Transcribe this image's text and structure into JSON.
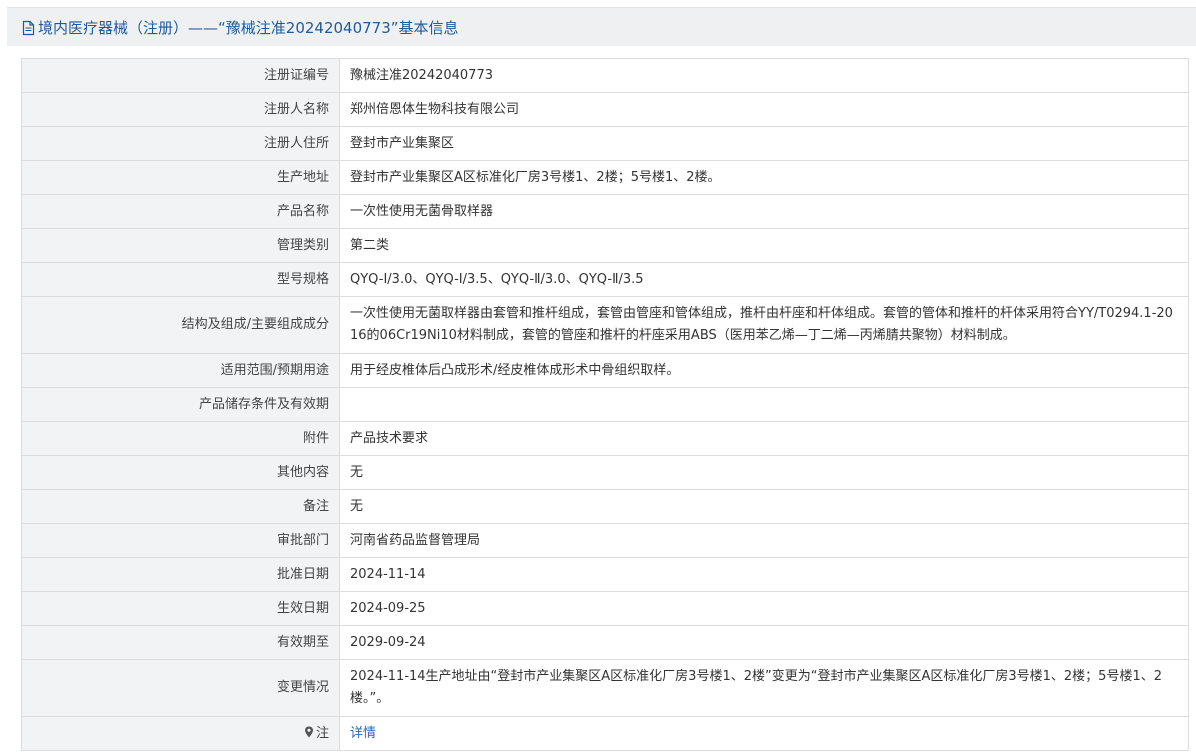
{
  "header": {
    "title": "境内医疗器械（注册）——“豫械注准20242040773”基本信息",
    "icon": "document-icon"
  },
  "rows": [
    {
      "key": "reg_no",
      "label": "注册证编号",
      "value": "豫械注准20242040773"
    },
    {
      "key": "registrant",
      "label": "注册人名称",
      "value": "郑州倍恩体生物科技有限公司"
    },
    {
      "key": "registrant_addr",
      "label": "注册人住所",
      "value": "登封市产业集聚区"
    },
    {
      "key": "production_addr",
      "label": "生产地址",
      "value": "登封市产业集聚区A区标准化厂房3号楼1、2楼；5号楼1、2楼。"
    },
    {
      "key": "product_name",
      "label": "产品名称",
      "value": "一次性使用无菌骨取样器"
    },
    {
      "key": "category",
      "label": "管理类别",
      "value": "第二类"
    },
    {
      "key": "models",
      "label": "型号规格",
      "value": "QYQ-Ⅰ/3.0、QYQ-Ⅰ/3.5、QYQ-Ⅱ/3.0、QYQ-Ⅱ/3.5"
    },
    {
      "key": "structure",
      "label": "结构及组成/主要组成成分",
      "value": "一次性使用无菌取样器由套管和推杆组成，套管由管座和管体组成，推杆由杆座和杆体组成。套管的管体和推杆的杆体采用符合YY/T0294.1-2016的06Cr19Ni10材料制成，套管的管座和推杆的杆座采用ABS（医用苯乙烯—丁二烯—丙烯腈共聚物）材料制成。"
    },
    {
      "key": "scope",
      "label": "适用范围/预期用途",
      "value": "用于经皮椎体后凸成形术/经皮椎体成形术中骨组织取样。"
    },
    {
      "key": "storage",
      "label": "产品储存条件及有效期",
      "value": ""
    },
    {
      "key": "attachment",
      "label": "附件",
      "value": "产品技术要求"
    },
    {
      "key": "other",
      "label": "其他内容",
      "value": "无"
    },
    {
      "key": "remark",
      "label": "备注",
      "value": "无"
    },
    {
      "key": "dept",
      "label": "审批部门",
      "value": "河南省药品监督管理局"
    },
    {
      "key": "approve_date",
      "label": "批准日期",
      "value": "2024-11-14"
    },
    {
      "key": "effective_date",
      "label": "生效日期",
      "value": "2024-09-25"
    },
    {
      "key": "expiry_date",
      "label": "有效期至",
      "value": "2029-09-24"
    },
    {
      "key": "changes",
      "label": "变更情况",
      "value": "2024-11-14生产地址由“登封市产业集聚区A区标准化厂房3号楼1、2楼”变更为“登封市产业集聚区A区标准化厂房3号楼1、2楼；5号楼1、2楼。”。"
    }
  ],
  "note": {
    "label": "注",
    "icon": "map-pin-icon",
    "link_text": "详情"
  },
  "colors": {
    "header_bg": "#eef0f1",
    "header_text": "#1f5a9a",
    "label_bg": "#f2f3f4",
    "border": "#dcdcdc",
    "link": "#2a67b0"
  }
}
